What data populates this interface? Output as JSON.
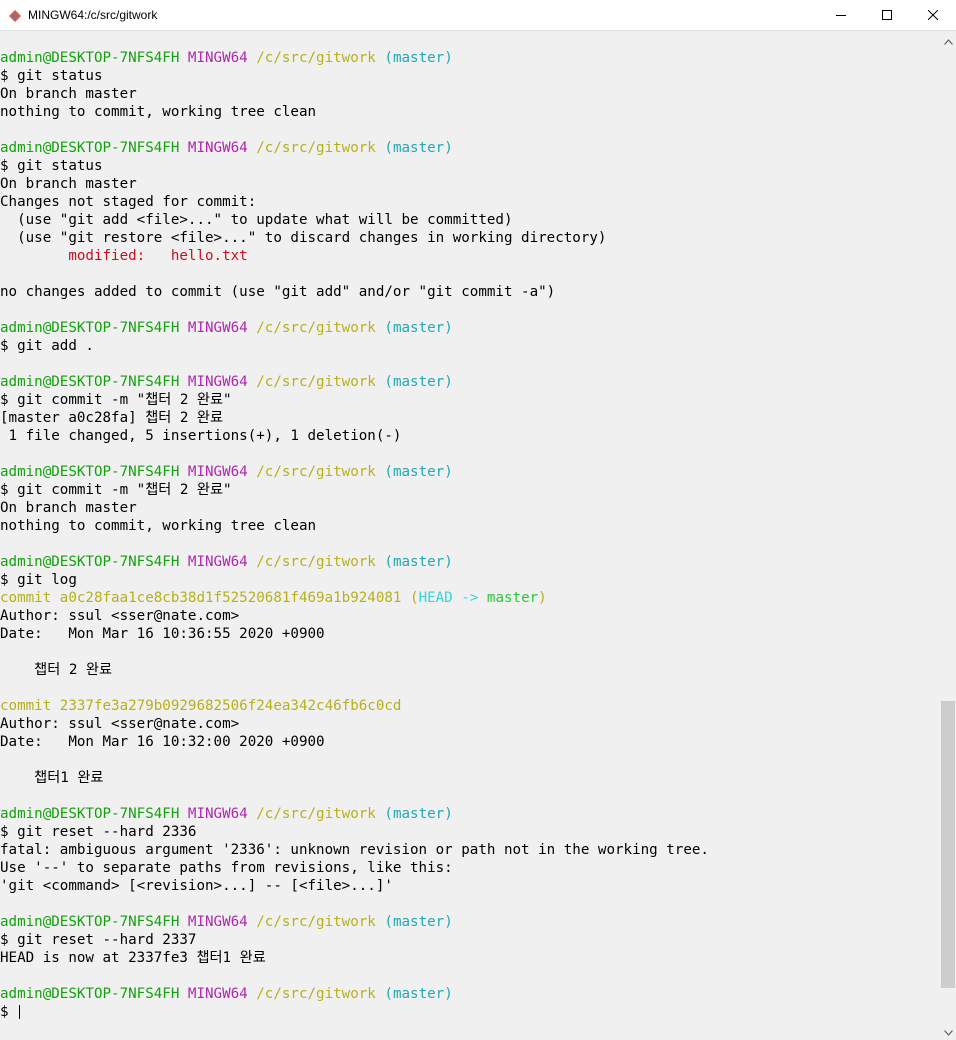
{
  "window": {
    "title": "MINGW64:/c/src/gitwork",
    "icon": "git-bash-icon",
    "minimize_icon": "minimize-icon",
    "maximize_icon": "maximize-icon",
    "close_icon": "close-icon"
  },
  "colors": {
    "user": "#13a10e",
    "host": "#b125b1",
    "path": "#b7b01c",
    "branch": "#22a8b8",
    "modified": "#c50f1f"
  },
  "prompt": {
    "user": "admin@DESKTOP-7NFS4FH",
    "host": "MINGW64",
    "path": "/c/src/gitwork",
    "branch": "(master)"
  },
  "terminal": {
    "lines": [
      {
        "type": "blank"
      },
      {
        "type": "prompt"
      },
      {
        "type": "text",
        "text": "$ git status"
      },
      {
        "type": "text",
        "text": "On branch master"
      },
      {
        "type": "text",
        "text": "nothing to commit, working tree clean"
      },
      {
        "type": "blank"
      },
      {
        "type": "prompt"
      },
      {
        "type": "text",
        "text": "$ git status"
      },
      {
        "type": "text",
        "text": "On branch master"
      },
      {
        "type": "text",
        "text": "Changes not staged for commit:"
      },
      {
        "type": "text",
        "text": "  (use \"git add <file>...\" to update what will be committed)"
      },
      {
        "type": "text",
        "text": "  (use \"git restore <file>...\" to discard changes in working directory)"
      },
      {
        "type": "red",
        "text": "        modified:   hello.txt"
      },
      {
        "type": "blank"
      },
      {
        "type": "text",
        "text": "no changes added to commit (use \"git add\" and/or \"git commit -a\")"
      },
      {
        "type": "blank"
      },
      {
        "type": "prompt"
      },
      {
        "type": "text",
        "text": "$ git add ."
      },
      {
        "type": "blank"
      },
      {
        "type": "prompt"
      },
      {
        "type": "text",
        "text": "$ git commit -m \"챕터 2 완료\""
      },
      {
        "type": "text",
        "text": "[master a0c28fa] 챕터 2 완료"
      },
      {
        "type": "text",
        "text": " 1 file changed, 5 insertions(+), 1 deletion(-)"
      },
      {
        "type": "blank"
      },
      {
        "type": "prompt"
      },
      {
        "type": "text",
        "text": "$ git commit -m \"챕터 2 완료\""
      },
      {
        "type": "text",
        "text": "On branch master"
      },
      {
        "type": "text",
        "text": "nothing to commit, working tree clean"
      },
      {
        "type": "blank"
      },
      {
        "type": "prompt"
      },
      {
        "type": "text",
        "text": "$ git log"
      },
      {
        "type": "commit_head",
        "commit": "commit a0c28faa1ce8cb38d1f52520681f469a1b924081",
        "open": " (",
        "head": "HEAD",
        "arrow": " -> ",
        "branch": "master",
        "close": ")"
      },
      {
        "type": "text",
        "text": "Author: ssul <sser@nate.com>"
      },
      {
        "type": "text",
        "text": "Date:   Mon Mar 16 10:36:55 2020 +0900"
      },
      {
        "type": "blank"
      },
      {
        "type": "text",
        "text": "    챕터 2 완료"
      },
      {
        "type": "blank"
      },
      {
        "type": "commit",
        "text": "commit 2337fe3a279b0929682506f24ea342c46fb6c0cd"
      },
      {
        "type": "text",
        "text": "Author: ssul <sser@nate.com>"
      },
      {
        "type": "text",
        "text": "Date:   Mon Mar 16 10:32:00 2020 +0900"
      },
      {
        "type": "blank"
      },
      {
        "type": "text",
        "text": "    챕터1 완료"
      },
      {
        "type": "blank"
      },
      {
        "type": "prompt"
      },
      {
        "type": "text",
        "text": "$ git reset --hard 2336"
      },
      {
        "type": "text",
        "text": "fatal: ambiguous argument '2336': unknown revision or path not in the working tree."
      },
      {
        "type": "text",
        "text": "Use '--' to separate paths from revisions, like this:"
      },
      {
        "type": "text",
        "text": "'git <command> [<revision>...] -- [<file>...]'"
      },
      {
        "type": "blank"
      },
      {
        "type": "prompt"
      },
      {
        "type": "text",
        "text": "$ git reset --hard 2337"
      },
      {
        "type": "text",
        "text": "HEAD is now at 2337fe3 챕터1 완료"
      },
      {
        "type": "blank"
      },
      {
        "type": "prompt"
      },
      {
        "type": "cursor",
        "text": "$ "
      }
    ]
  },
  "scrollbar": {
    "up_icon": "scroll-up-arrow-icon",
    "down_icon": "scroll-down-arrow-icon",
    "thumb_start_fraction": 0.67,
    "thumb_end_fraction": 0.965
  }
}
